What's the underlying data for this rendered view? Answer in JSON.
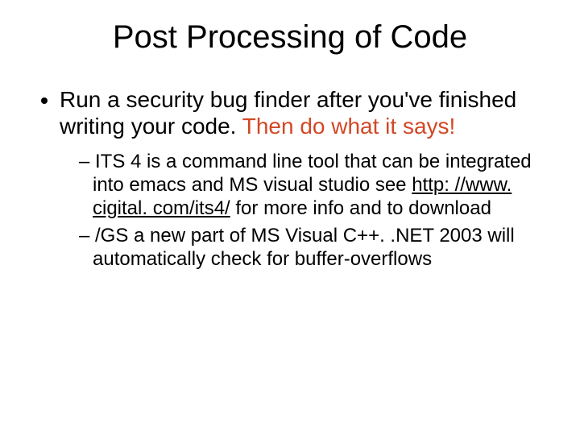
{
  "title": "Post Processing of Code",
  "bullet1": {
    "lead": "Run a security bug finder after you've finished writing your code. ",
    "emph": "Then do what it says!"
  },
  "sub": [
    {
      "pre": "ITS 4 is a command line tool that can be integrated into emacs and MS visual studio see ",
      "url": "http: //www. cigital. com/its4/",
      "post": " for more info and to download"
    },
    {
      "text": "/GS a new part of MS Visual C++. .NET 2003 will automatically check for buffer-overflows"
    }
  ],
  "colors": {
    "emph": "#d24726"
  }
}
